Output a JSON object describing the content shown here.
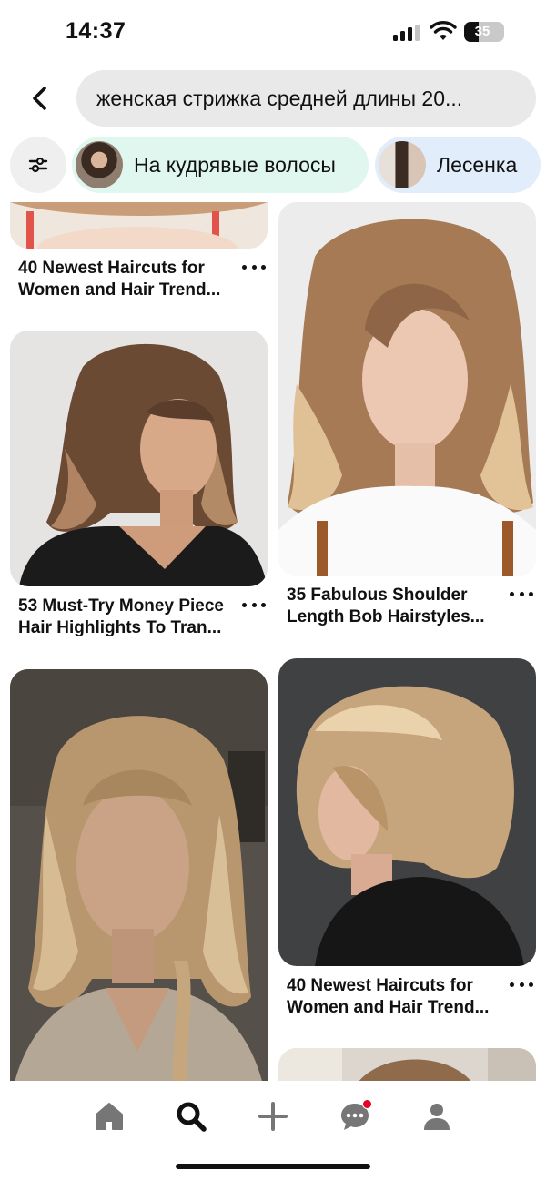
{
  "status_bar": {
    "time": "14:37",
    "battery": "35"
  },
  "search": {
    "query": "женская стрижка средней длины 20..."
  },
  "chips": [
    {
      "label": "На кудрявые волосы",
      "bg": "#dff7ee"
    },
    {
      "label": "Лесенка",
      "bg": "#e1edfb"
    }
  ],
  "pins": [
    {
      "line1": "40 Newest Haircuts for",
      "line2": "Women and Hair Trend..."
    },
    {
      "line1": "53 Must-Try Money Piece",
      "line2": "Hair Highlights To Tran..."
    },
    {
      "line1": "35 Fabulous Shoulder",
      "line2": "Length Bob Hairstyles..."
    },
    {
      "line1": "40 Newest Haircuts for",
      "line2": "Women and Hair Trend..."
    }
  ],
  "nav": {
    "items": [
      "home-icon",
      "search-icon",
      "plus-icon",
      "messages-icon",
      "profile-icon"
    ],
    "active": "search-icon",
    "notification_color": "#e60023"
  }
}
